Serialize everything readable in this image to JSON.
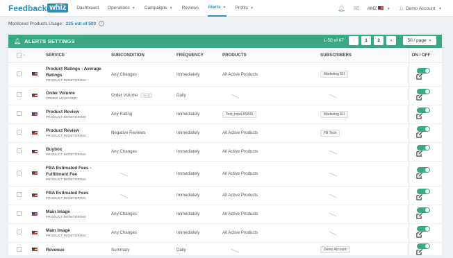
{
  "nav": {
    "logo_a": "Feedback",
    "logo_b": "whiz",
    "items": [
      {
        "label": "Dashboard",
        "caret": false
      },
      {
        "label": "Operations",
        "caret": true
      },
      {
        "label": "Campaigns",
        "caret": true
      },
      {
        "label": "Reviews",
        "caret": false
      },
      {
        "label": "Alerts",
        "caret": true,
        "active": true
      },
      {
        "label": "Profits",
        "caret": true
      }
    ],
    "marketplace": "AMZ",
    "account": "Demo Account"
  },
  "usage": {
    "label": "Monitored Products Usage:",
    "value": "225 out of 500"
  },
  "panel": {
    "title": "ALERTS SETTINGS",
    "range": "1-50 of 67",
    "pages": [
      "1",
      "2"
    ],
    "per_page": "50 / page"
  },
  "columns": [
    "SERVICE",
    "SUBCONDITION",
    "FREQUENCY",
    "PRODUCTS",
    "SUBSCRIBERS",
    "ON / OFF"
  ],
  "rows": [
    {
      "name": "Product Ratings - Average Ratings",
      "sub": "PRODUCT MONITORING",
      "subcondition": "Any Changes",
      "frequency": "Immediately",
      "products": "All Active Products",
      "subscribers": "Marketing EU",
      "h": 34
    },
    {
      "name": "Order Volume",
      "sub": "ORDER MANAGER",
      "subcondition": "Order Volume",
      "subcond_badge": ">= 1",
      "frequency": "Daily",
      "products": "",
      "subscribers": "",
      "h": 27
    },
    {
      "name": "Product Review",
      "sub": "PRODUCT MONITORING",
      "subcondition": "Any Rating",
      "frequency": "Immediately",
      "products_badge": "Test_Input ASINS",
      "subscribers": "Marketing EU",
      "h": 27
    },
    {
      "name": "Product Review",
      "sub": "PRODUCT MONITORING",
      "subcondition": "Negative Reviews",
      "frequency": "Immediately",
      "products": "All Active Products",
      "subscribers": "FB Tech",
      "h": 27
    },
    {
      "name": "Buybox",
      "sub": "PRODUCT MONITORING",
      "subcondition": "Any Changes",
      "frequency": "Immediately",
      "products": "All Active Products",
      "subscribers": "",
      "h": 27
    },
    {
      "name": "FBA Estimated Fees - Fulfillment Fee",
      "sub": "PRODUCT MONITORING",
      "subcondition": "",
      "frequency": "Immediately",
      "products": "All Active Products",
      "subscribers": "",
      "h": 36
    },
    {
      "name": "FBA Estimated Fees",
      "sub": "PRODUCT MONITORING",
      "subcondition": "",
      "frequency": "Immediately",
      "products": "All Active Products",
      "subscribers": "",
      "h": 27
    },
    {
      "name": "Main Image",
      "sub": "PRODUCT MONITORING",
      "subcondition": "Any Changes",
      "frequency": "Immediately",
      "products": "All Active Products",
      "subscribers": "",
      "h": 27
    },
    {
      "name": "Main Image",
      "sub": "PRODUCT MONITORING",
      "subcondition": "Any Changes",
      "frequency": "Immediately",
      "products": "All Active Products",
      "subscribers": "",
      "h": 27
    },
    {
      "name": "Revenue",
      "sub": "",
      "subcondition": "Summary",
      "frequency": "Daily",
      "products": "",
      "subscribers": "Demo Account",
      "h": 22
    }
  ]
}
